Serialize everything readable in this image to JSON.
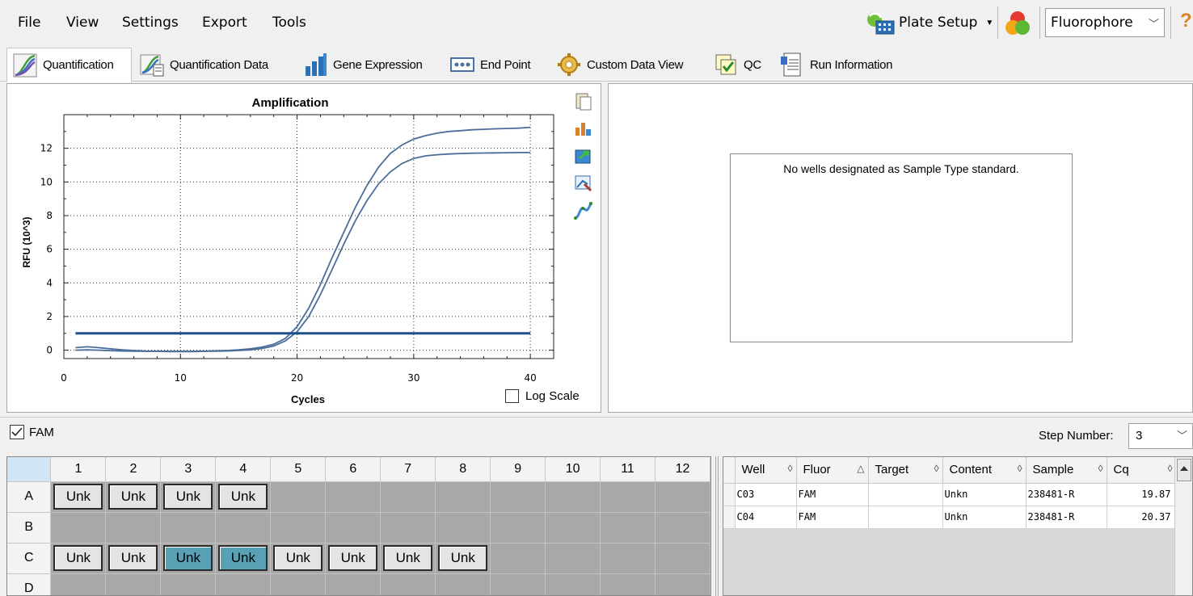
{
  "menu": {
    "items": [
      "File",
      "View",
      "Settings",
      "Export",
      "Tools"
    ],
    "plate_setup": "Plate Setup",
    "fluorophore": "Fluorophore",
    "help": "?"
  },
  "tabs": [
    {
      "label": "Quantification",
      "icon": "amplification-curve-icon"
    },
    {
      "label": "Quantification Data",
      "icon": "quantification-data-icon"
    },
    {
      "label": "Gene Expression",
      "icon": "bar-chart-icon"
    },
    {
      "label": "End Point",
      "icon": "end-point-icon"
    },
    {
      "label": "Custom Data View",
      "icon": "gear-icon"
    },
    {
      "label": "QC",
      "icon": "qc-icon"
    },
    {
      "label": "Run Information",
      "icon": "document-icon"
    }
  ],
  "chart_data": {
    "type": "line",
    "title": "Amplification",
    "xlabel": "Cycles",
    "ylabel": "RFU (10^3)",
    "xlim": [
      0,
      42
    ],
    "ylim": [
      -0.5,
      14
    ],
    "xticks": [
      0,
      10,
      20,
      30,
      40
    ],
    "yticks": [
      0,
      2,
      4,
      6,
      8,
      10,
      12
    ],
    "grid": "dotted",
    "threshold": 1.0,
    "series": [
      {
        "x": [
          1,
          2,
          3,
          4,
          5,
          6,
          7,
          8,
          9,
          10,
          11,
          12,
          13,
          14,
          15,
          16,
          17,
          18,
          19,
          20,
          21,
          22,
          23,
          24,
          25,
          26,
          27,
          28,
          29,
          30,
          31,
          32,
          33,
          34,
          35,
          36,
          37,
          38,
          39,
          40
        ],
        "y": [
          0.0,
          0.02,
          0.0,
          -0.03,
          -0.05,
          -0.06,
          -0.07,
          -0.07,
          -0.08,
          -0.08,
          -0.08,
          -0.07,
          -0.06,
          -0.05,
          -0.02,
          0.02,
          0.1,
          0.25,
          0.55,
          1.1,
          2.0,
          3.3,
          4.8,
          6.3,
          7.7,
          8.9,
          9.9,
          10.6,
          11.1,
          11.4,
          11.55,
          11.62,
          11.66,
          11.69,
          11.71,
          11.72,
          11.73,
          11.74,
          11.75,
          11.75
        ]
      },
      {
        "x": [
          1,
          2,
          3,
          4,
          5,
          6,
          7,
          8,
          9,
          10,
          11,
          12,
          13,
          14,
          15,
          16,
          17,
          18,
          19,
          20,
          21,
          22,
          23,
          24,
          25,
          26,
          27,
          28,
          29,
          30,
          31,
          32,
          33,
          34,
          35,
          36,
          37,
          38,
          39,
          40
        ],
        "y": [
          0.15,
          0.2,
          0.15,
          0.08,
          0.02,
          -0.02,
          -0.05,
          -0.06,
          -0.07,
          -0.07,
          -0.07,
          -0.06,
          -0.04,
          -0.02,
          0.02,
          0.08,
          0.18,
          0.35,
          0.7,
          1.4,
          2.5,
          3.9,
          5.5,
          7.0,
          8.5,
          9.8,
          10.9,
          11.7,
          12.2,
          12.55,
          12.75,
          12.9,
          13.0,
          13.05,
          13.1,
          13.13,
          13.16,
          13.18,
          13.2,
          13.25
        ]
      }
    ]
  },
  "chart_tools": [
    "copy-icon",
    "chart-options-icon",
    "export-icon",
    "zoom-icon",
    "curve-icon"
  ],
  "log_scale_label": "Log Scale",
  "standard_message": "No wells designated as Sample Type standard.",
  "fluor_checkbox": "FAM",
  "step_number": {
    "label": "Step Number:",
    "value": "3"
  },
  "plate": {
    "columns": [
      "1",
      "2",
      "3",
      "4",
      "5",
      "6",
      "7",
      "8",
      "9",
      "10",
      "11",
      "12"
    ],
    "rows": [
      {
        "label": "A",
        "wells": [
          "Unk",
          "Unk",
          "Unk",
          "Unk",
          "",
          "",
          "",
          "",
          "",
          "",
          "",
          ""
        ],
        "selected": []
      },
      {
        "label": "B",
        "wells": [
          "",
          "",
          "",
          "",
          "",
          "",
          "",
          "",
          "",
          "",
          "",
          ""
        ],
        "selected": []
      },
      {
        "label": "C",
        "wells": [
          "Unk",
          "Unk",
          "Unk",
          "Unk",
          "Unk",
          "Unk",
          "Unk",
          "Unk",
          "",
          "",
          "",
          ""
        ],
        "selected": [
          2,
          3
        ]
      },
      {
        "label": "D",
        "wells": [
          "",
          "",
          "",
          "",
          "",
          "",
          "",
          "",
          "",
          "",
          "",
          ""
        ],
        "selected": []
      }
    ]
  },
  "grid": {
    "headers": [
      "Well",
      "Fluor",
      "Target",
      "Content",
      "Sample",
      "Cq"
    ],
    "sort_icons": [
      "◊",
      "△",
      "◊",
      "◊",
      "◊",
      "◊"
    ],
    "rows": [
      [
        "C03",
        "FAM",
        "",
        "Unkn",
        "238481-R",
        "19.87"
      ],
      [
        "C04",
        "FAM",
        "",
        "Unkn",
        "238481-R",
        "20.37"
      ]
    ]
  }
}
